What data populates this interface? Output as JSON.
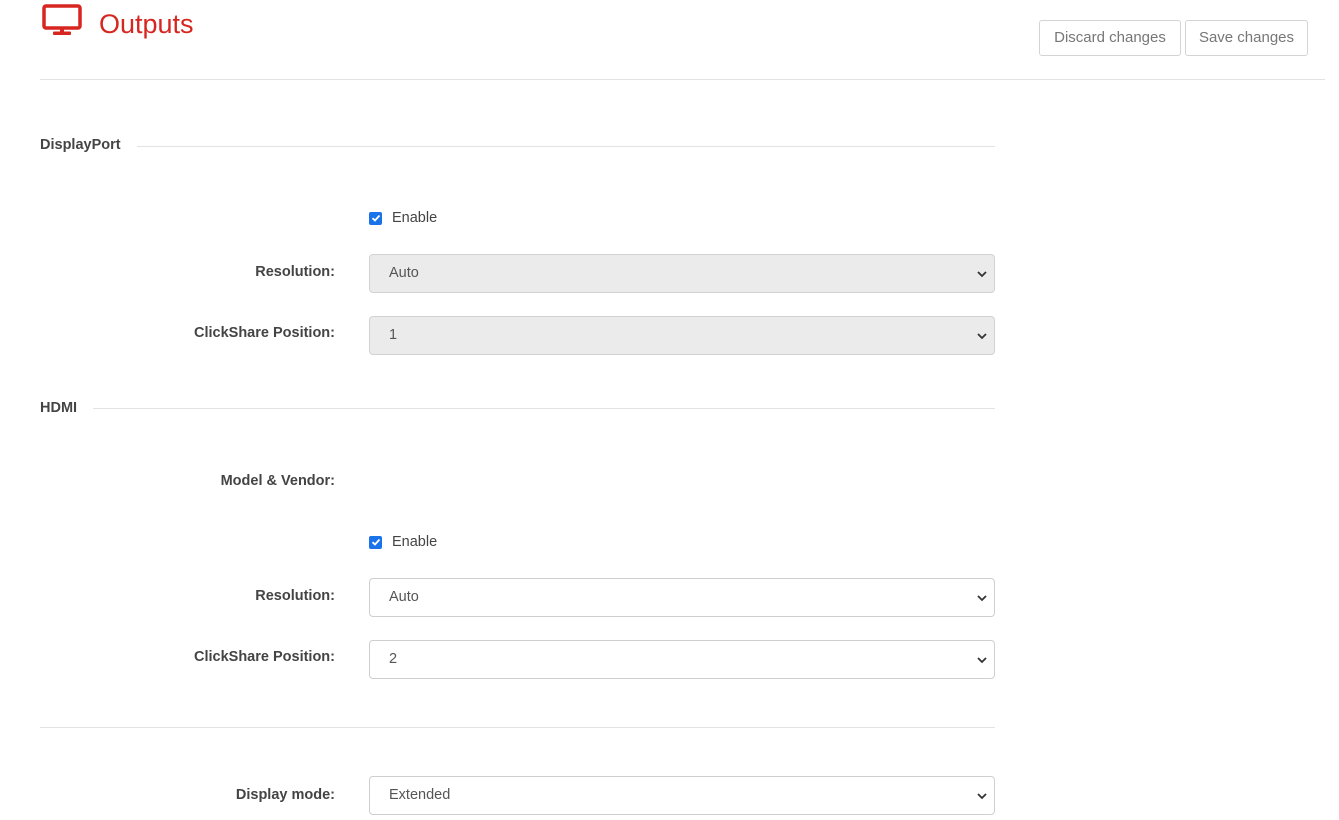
{
  "header": {
    "title": "Outputs",
    "icon": "monitor-icon",
    "accent_color": "#d7261f",
    "discard_label": "Discard changes",
    "save_label": "Save changes"
  },
  "displayport": {
    "section_title": "DisplayPort",
    "enable_label": "Enable",
    "enabled": true,
    "resolution_label": "Resolution:",
    "resolution_value": "Auto",
    "position_label": "ClickShare Position:",
    "position_value": "1",
    "disabled": true
  },
  "hdmi": {
    "section_title": "HDMI",
    "model_label": "Model & Vendor:",
    "enable_label": "Enable",
    "enabled": true,
    "resolution_label": "Resolution:",
    "resolution_value": "Auto",
    "position_label": "ClickShare Position:",
    "position_value": "2",
    "disabled": false
  },
  "display_mode": {
    "label": "Display mode:",
    "value": "Extended"
  }
}
